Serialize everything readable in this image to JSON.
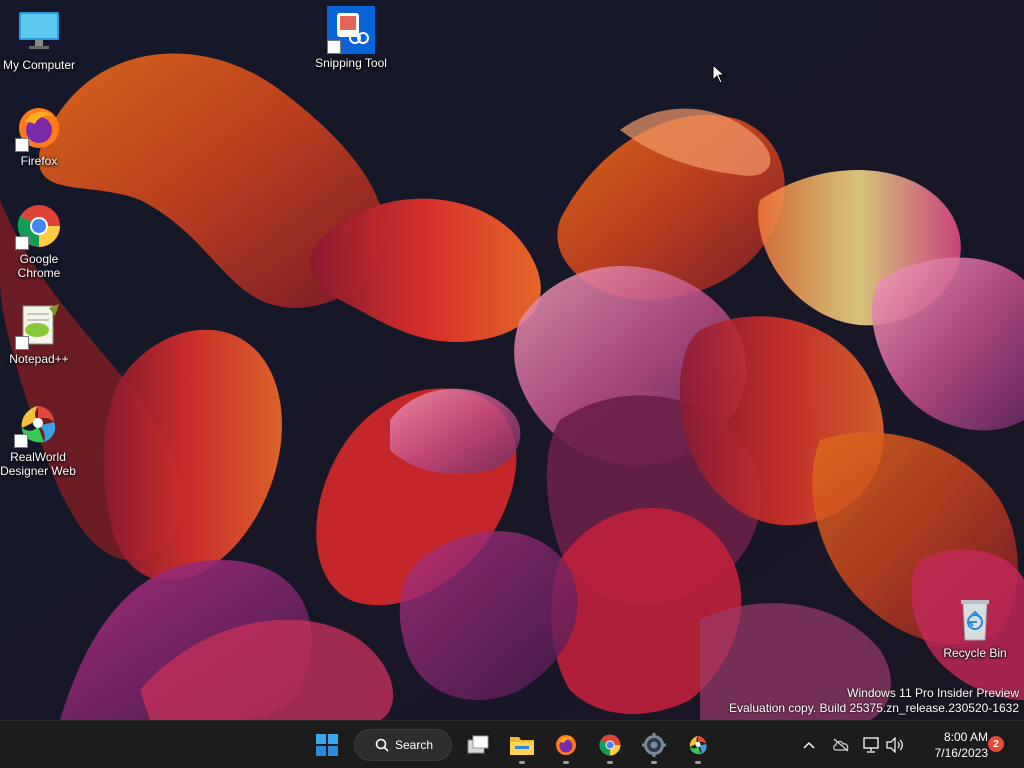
{
  "desktop": {
    "icons": [
      {
        "label": "My Computer"
      },
      {
        "label": "Snipping Tool"
      },
      {
        "label": "Firefox"
      },
      {
        "label": "Google Chrome"
      },
      {
        "label": "Notepad++"
      },
      {
        "label": "RealWorld Designer Web"
      },
      {
        "label": "Recycle Bin"
      }
    ],
    "watermark": {
      "line1": "Windows 11 Pro Insider Preview",
      "line2": "Evaluation copy. Build 25375.zn_release.230520-1632"
    }
  },
  "taskbar": {
    "search_label": "Search",
    "apps": [
      {
        "icon": "start-icon",
        "running": false
      },
      {
        "icon": "task-view-icon",
        "running": false
      },
      {
        "icon": "file-explorer-icon",
        "running": true
      },
      {
        "icon": "firefox-icon",
        "running": true
      },
      {
        "icon": "chrome-icon",
        "running": true
      },
      {
        "icon": "settings-icon",
        "running": true
      },
      {
        "icon": "realworld-icon",
        "running": true
      }
    ],
    "tray": {
      "time": "8:00 AM",
      "date": "7/16/2023",
      "notification_count": "2"
    }
  },
  "colors": {
    "taskbar_bg": "#1c1c1c",
    "accent": "#0a64d8",
    "badge": "#e24a3b"
  }
}
